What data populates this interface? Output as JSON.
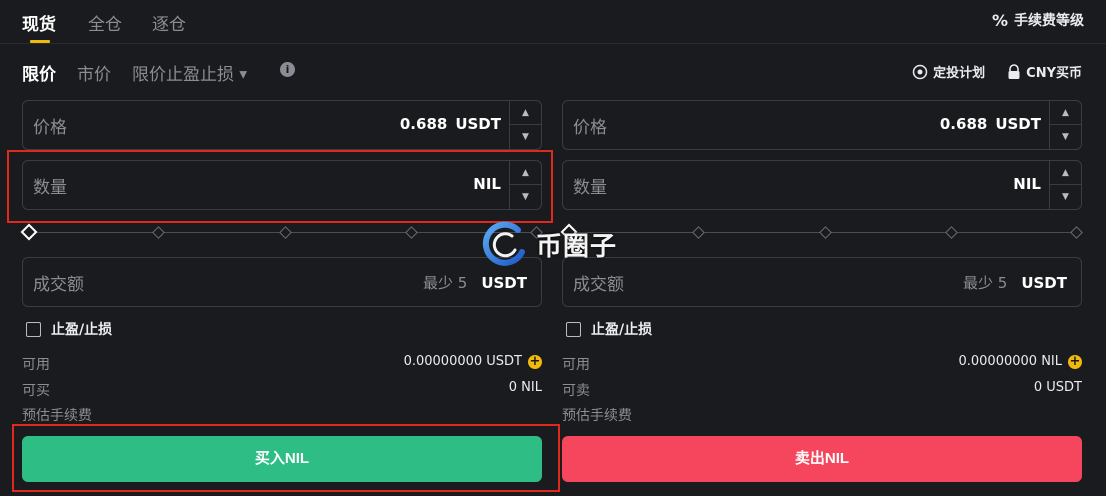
{
  "top_tabs": {
    "spot": "现货",
    "cross": "全仓",
    "isolated": "逐仓",
    "fee_level": "手续费等级"
  },
  "order_tabs": {
    "limit": "限价",
    "market": "市价",
    "stop_limit": "限价止盈止损"
  },
  "right_links": {
    "auto_invest": "定投计划",
    "buy_cny": "CNY买币"
  },
  "buy": {
    "price_label": "价格",
    "price_value": "0.688",
    "price_unit": "USDT",
    "amount_label": "数量",
    "amount_unit": "NIL",
    "total_label": "成交额",
    "total_hint": "最少 5",
    "total_unit": "USDT",
    "tpsl_label": "止盈/止损",
    "available_label": "可用",
    "available_value": "0.00000000 USDT",
    "max_label": "可买",
    "max_value": "0 NIL",
    "fee_label": "预估手续费",
    "button_label": "买入NIL",
    "slider_level": 0
  },
  "sell": {
    "price_label": "价格",
    "price_value": "0.688",
    "price_unit": "USDT",
    "amount_label": "数量",
    "amount_unit": "NIL",
    "total_label": "成交额",
    "total_hint": "最少 5",
    "total_unit": "USDT",
    "tpsl_label": "止盈/止损",
    "available_label": "可用",
    "available_value": "0.00000000 NIL",
    "max_label": "可卖",
    "max_value": "0 USDT",
    "fee_label": "预估手续费",
    "button_label": "卖出NIL",
    "slider_level": 0
  },
  "watermark": {
    "text": "币圈子"
  },
  "colors": {
    "accent": "#f0b90b",
    "buy": "#2ebd85",
    "sell": "#f6465d",
    "highlight": "#e0281e"
  }
}
